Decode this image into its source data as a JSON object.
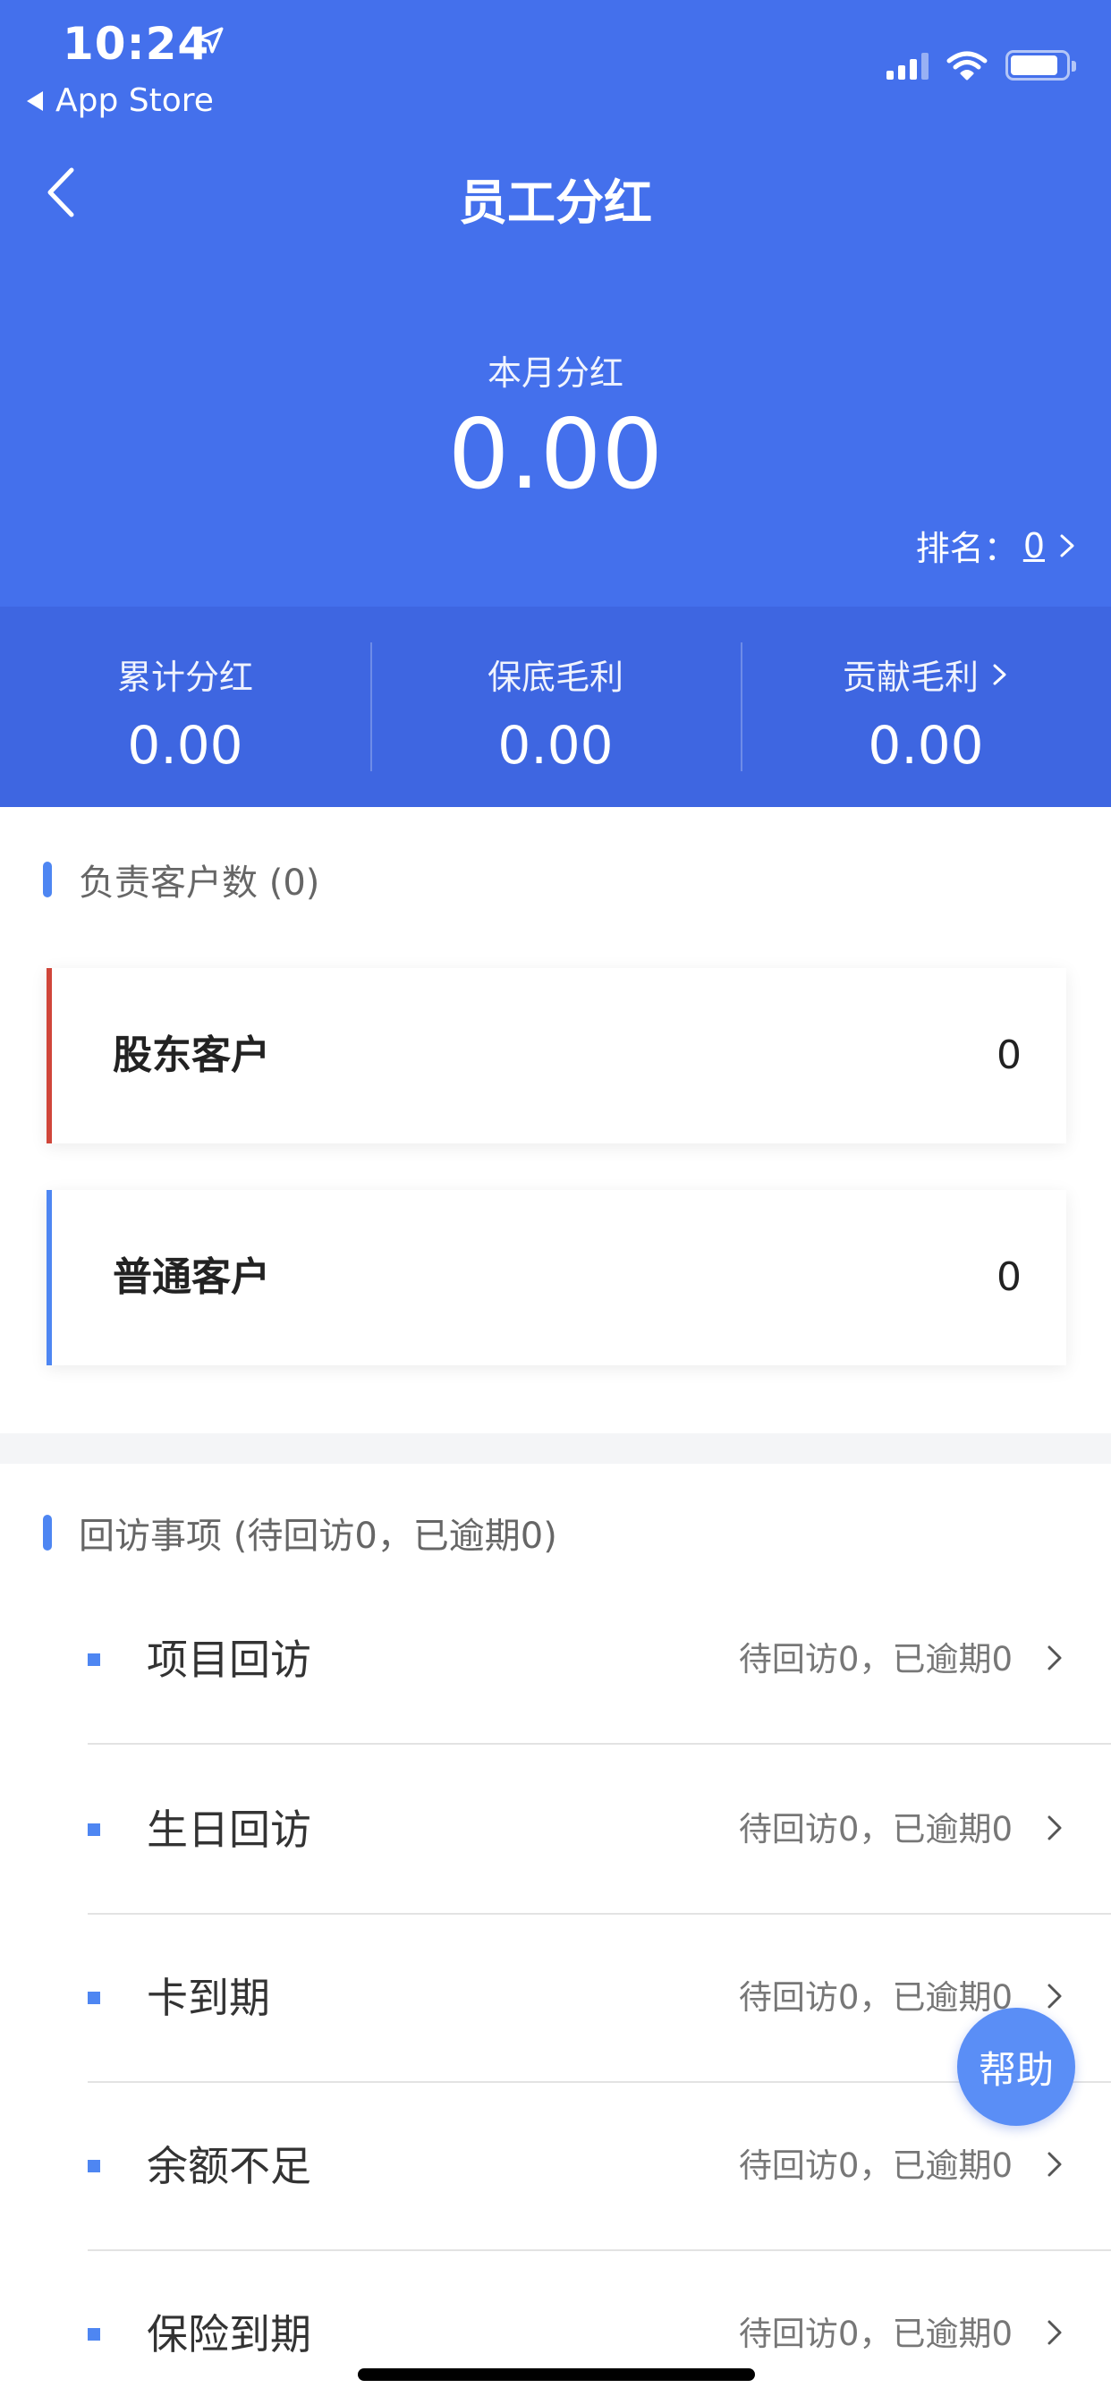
{
  "status_bar": {
    "time": "10:24",
    "back_app": "App Store"
  },
  "nav": {
    "title": "员工分红"
  },
  "summary": {
    "month_label": "本月分红",
    "month_value": "0.00",
    "rank_label": "排名：",
    "rank_value": "0"
  },
  "stats": [
    {
      "label": "累计分红",
      "value": "0.00"
    },
    {
      "label": "保底毛利",
      "value": "0.00"
    },
    {
      "label": "贡献毛利",
      "value": "0.00"
    }
  ],
  "customers": {
    "title": "负责客户数 (0)",
    "cards": [
      {
        "label": "股东客户",
        "value": "0",
        "accent": "#D0463A"
      },
      {
        "label": "普通客户",
        "value": "0",
        "accent": "#4E86F2"
      }
    ]
  },
  "visits": {
    "title": "回访事项 (待回访0，已逾期0)",
    "items": [
      {
        "label": "项目回访",
        "status": "待回访0，已逾期0"
      },
      {
        "label": "生日回访",
        "status": "待回访0，已逾期0"
      },
      {
        "label": "卡到期",
        "status": "待回访0，已逾期0"
      },
      {
        "label": "余额不足",
        "status": "待回访0，已逾期0"
      },
      {
        "label": "保险到期",
        "status": "待回访0，已逾期0"
      }
    ]
  },
  "help_button": "帮助",
  "colors": {
    "header": "#4470EC",
    "stats_bar": "#3E66E1",
    "accent_blue": "#4E86F2",
    "accent_red": "#D0463A"
  }
}
